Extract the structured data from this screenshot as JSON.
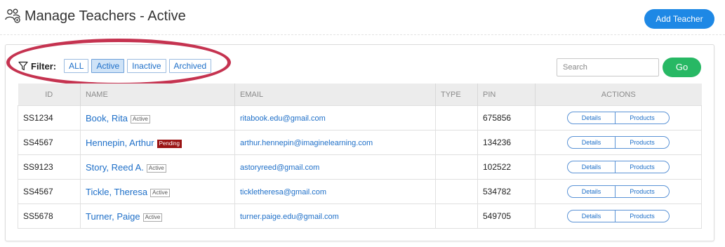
{
  "header": {
    "title": "Manage Teachers - Active",
    "icon": "teachers-icon",
    "add_button": "Add Teacher"
  },
  "filter": {
    "label": "Filter:",
    "icon": "filter-icon",
    "options": [
      "ALL",
      "Active",
      "Inactive",
      "Archived"
    ],
    "selected": "Active"
  },
  "search": {
    "placeholder": "Search",
    "value": "",
    "go_label": "Go"
  },
  "table": {
    "columns": [
      "ID",
      "NAME",
      "EMAIL",
      "TYPE",
      "PIN",
      "ACTIONS"
    ],
    "rows": [
      {
        "id": "SS1234",
        "name": "Book, Rita",
        "status": "Active",
        "email": "ritabook.edu@gmail.com",
        "type": "",
        "pin": "675856"
      },
      {
        "id": "SS4567",
        "name": "Hennepin, Arthur",
        "status": "Pending",
        "email": "arthur.hennepin@imaginelearning.com",
        "type": "",
        "pin": "134236"
      },
      {
        "id": "SS9123",
        "name": "Story, Reed A.",
        "status": "Active",
        "email": "astoryreed@gmail.com",
        "type": "",
        "pin": "102522"
      },
      {
        "id": "SS4567",
        "name": "Tickle, Theresa",
        "status": "Active",
        "email": "tickletheresa@gmail.com",
        "type": "",
        "pin": "534782"
      },
      {
        "id": "SS5678",
        "name": "Turner, Paige",
        "status": "Active",
        "email": "turner.paige.edu@gmail.com",
        "type": "",
        "pin": "549705"
      }
    ],
    "actions": [
      "Details",
      "Products"
    ]
  },
  "colors": {
    "primary": "#1e88e5",
    "go": "#27b864",
    "link": "#1e6fc8",
    "pending_badge": "#9a1414",
    "highlight": "#c53350"
  }
}
